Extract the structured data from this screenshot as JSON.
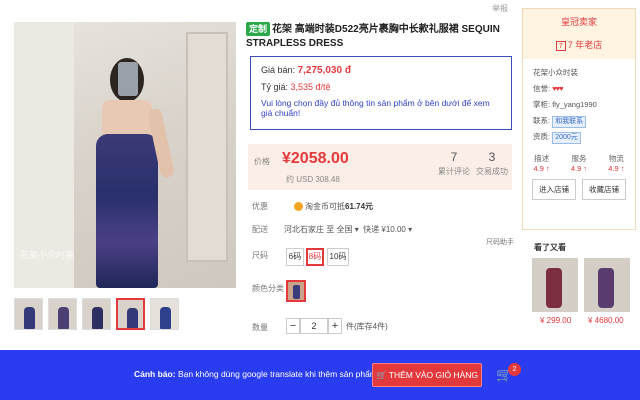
{
  "report_link": "举报",
  "title": {
    "tag": "定制",
    "text": "花架 高端时装D522亮片裹胸中长款礼服裙 SEQUIN STRAPLESS DRESS"
  },
  "price_box": {
    "price_label": "Giá bán:",
    "price_value": "7,275,030 đ",
    "rate_label": "Tỷ giá:",
    "rate_value": "3,535 đ/tệ",
    "note": "Vui lòng chọn đầy đủ thông tin sản phẩm ở bên dưới để xem giá chuẩn!"
  },
  "price_area": {
    "label": "价格",
    "price": "¥2058.00",
    "usd": "约 USD 308.48",
    "reviews_count": "7",
    "reviews_label": "累计评论",
    "sales_count": "3",
    "sales_label": "交易成功"
  },
  "promo": {
    "label": "优惠",
    "text": "淘金币可抵",
    "amount": "61.74元"
  },
  "shipping": {
    "label": "配送",
    "from": "河北石家庄 至",
    "to": "全国 ▾",
    "fee": "快递 ¥10.00 ▾"
  },
  "size": {
    "label": "尺码",
    "helper": "尺码助手",
    "options": [
      "6码",
      "8码",
      "10码"
    ],
    "selected": "8码"
  },
  "color": {
    "label": "颜色分类"
  },
  "quantity": {
    "label": "数量",
    "value": "2",
    "minus": "−",
    "plus": "+",
    "stock": "件(库存4件)"
  },
  "watermark": "花架小众时装",
  "shop": {
    "badge": "皇冠卖家",
    "years": "7 年老店",
    "years_icon": "7",
    "name": "花架小众时装",
    "credit_label": "信誉:",
    "credit_hearts": "♥♥♥",
    "owner_label": "掌柜:",
    "owner": "fly_yang1990",
    "contact_label": "联系:",
    "contact_btn": "和我联系",
    "deposit_label": "资质:",
    "deposit_btn": "2000元",
    "scores": [
      {
        "name": "描述",
        "value": "4.9 ↑"
      },
      {
        "name": "服务",
        "value": "4.9 ↑"
      },
      {
        "name": "物流",
        "value": "4.9 ↑"
      }
    ],
    "enter_btn": "进入店铺",
    "fav_btn": "收藏店铺"
  },
  "also_viewed": {
    "title": "看了又看",
    "items": [
      {
        "price": "¥ 299.00"
      },
      {
        "price": "¥ 4680.00"
      }
    ]
  },
  "bottom_bar": {
    "warning_bold": "Cảnh báo:",
    "warning_text": "Bạn không dùng google translate khi thêm sản phẩm!",
    "cart_button": "THÊM VÀO GIỎ HÀNG",
    "cart_count": "2"
  },
  "colors": {
    "accent": "#e4393c",
    "bar": "#2a3cf0",
    "box_border": "#3b4bb8"
  }
}
